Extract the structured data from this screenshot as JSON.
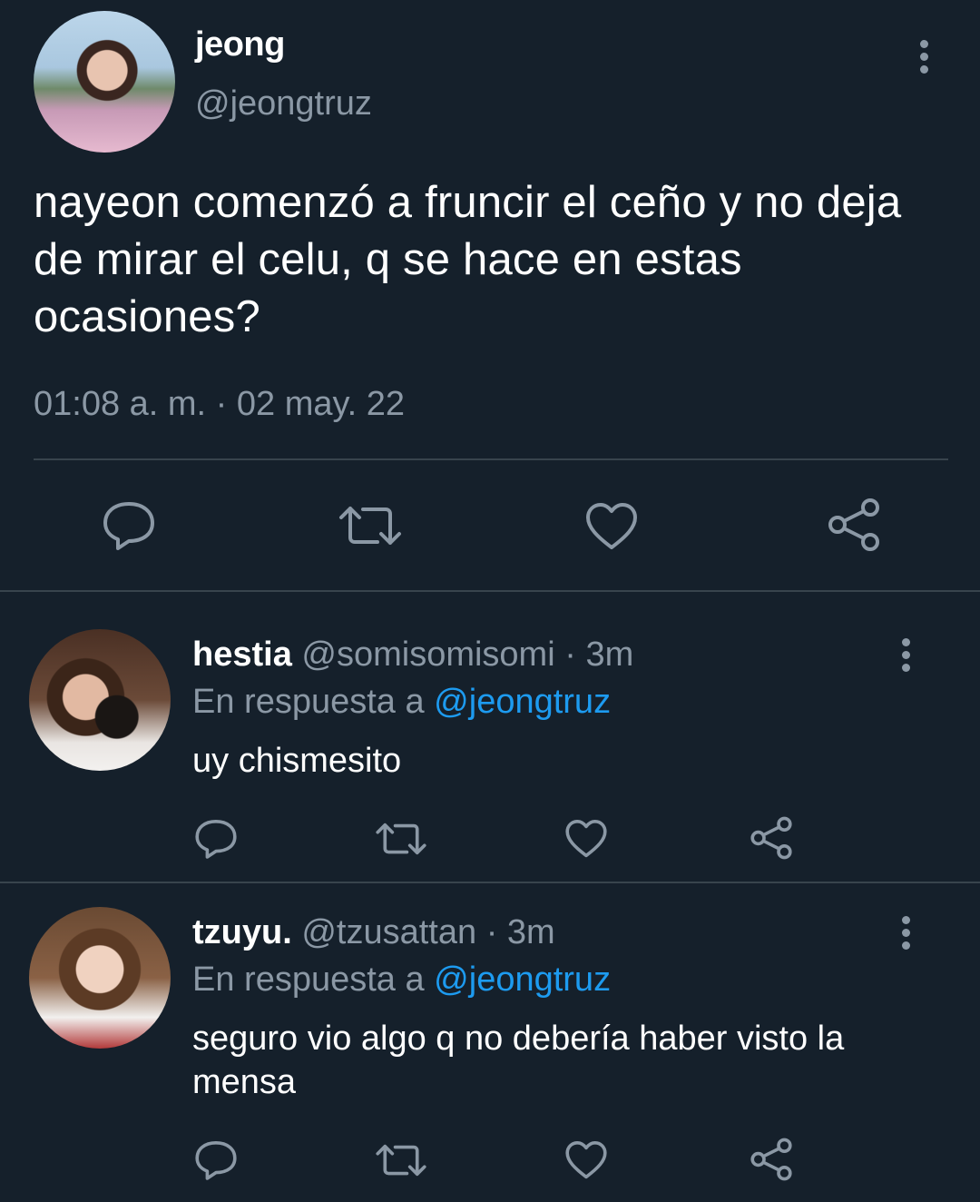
{
  "main_tweet": {
    "name": "jeong",
    "handle": "@jeongtruz",
    "text": "nayeon comenzó a fruncir el ceño y no deja de mirar el celu, q se hace en estas ocasiones?",
    "timestamp": "01:08 a. m. · 02 may. 22",
    "actions": [
      "reply-icon",
      "retweet-icon",
      "like-icon",
      "share-icon"
    ]
  },
  "replies": [
    {
      "name": "hestia",
      "handle": "@somisomisomi",
      "time": "· 3m",
      "replying_prefix": "En respuesta a",
      "replying_to": "@jeongtruz",
      "text": "uy chismesito"
    },
    {
      "name": "tzuyu.",
      "handle": "@tzusattan",
      "time": "· 3m",
      "replying_prefix": "En respuesta a",
      "replying_to": "@jeongtruz",
      "text": "seguro vio algo q no debería haber visto la mensa"
    }
  ],
  "colors": {
    "background": "#15202b",
    "secondary_text": "#8b98a5",
    "link": "#1d9bf0",
    "divider": "#38444d"
  }
}
